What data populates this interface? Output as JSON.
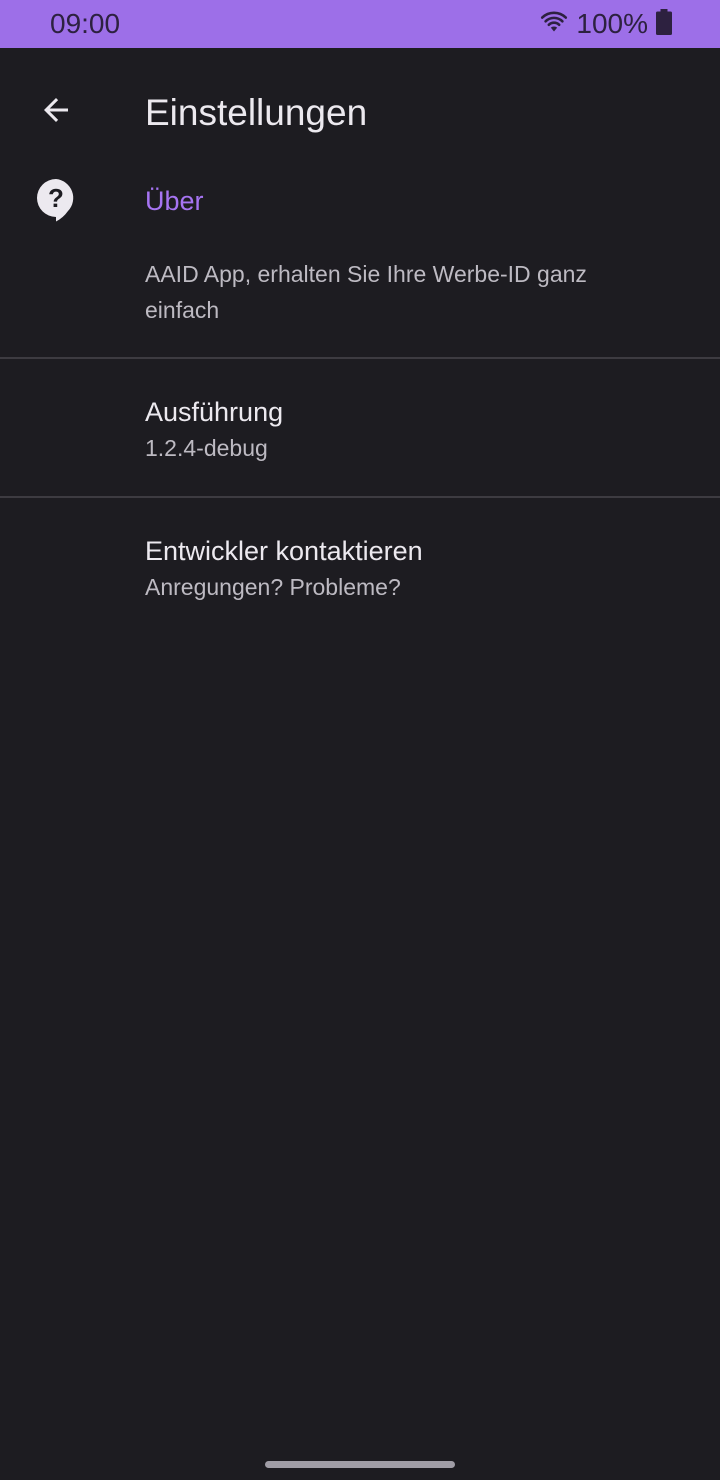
{
  "status_bar": {
    "time": "09:00",
    "battery_text": "100%",
    "wifi_icon": "wifi-icon",
    "battery_icon": "battery-full-icon",
    "background_color": "#9d6fe8"
  },
  "toolbar": {
    "back_icon": "arrow-back-icon",
    "title": "Einstellungen"
  },
  "about_section": {
    "icon": "help-bubble-icon",
    "title": "Über",
    "summary": "AAID App, erhalten Sie Ihre Werbe-ID ganz einfach",
    "accent_color": "#a674f2"
  },
  "items": [
    {
      "title": "Ausführung",
      "summary": "1.2.4-debug"
    },
    {
      "title": "Entwickler kontaktieren",
      "summary": "Anregungen? Probleme?"
    }
  ],
  "colors": {
    "background": "#1d1c21",
    "divider": "#3d3b41",
    "primary_text": "#ece9ef",
    "secondary_text": "#bdbac2"
  }
}
